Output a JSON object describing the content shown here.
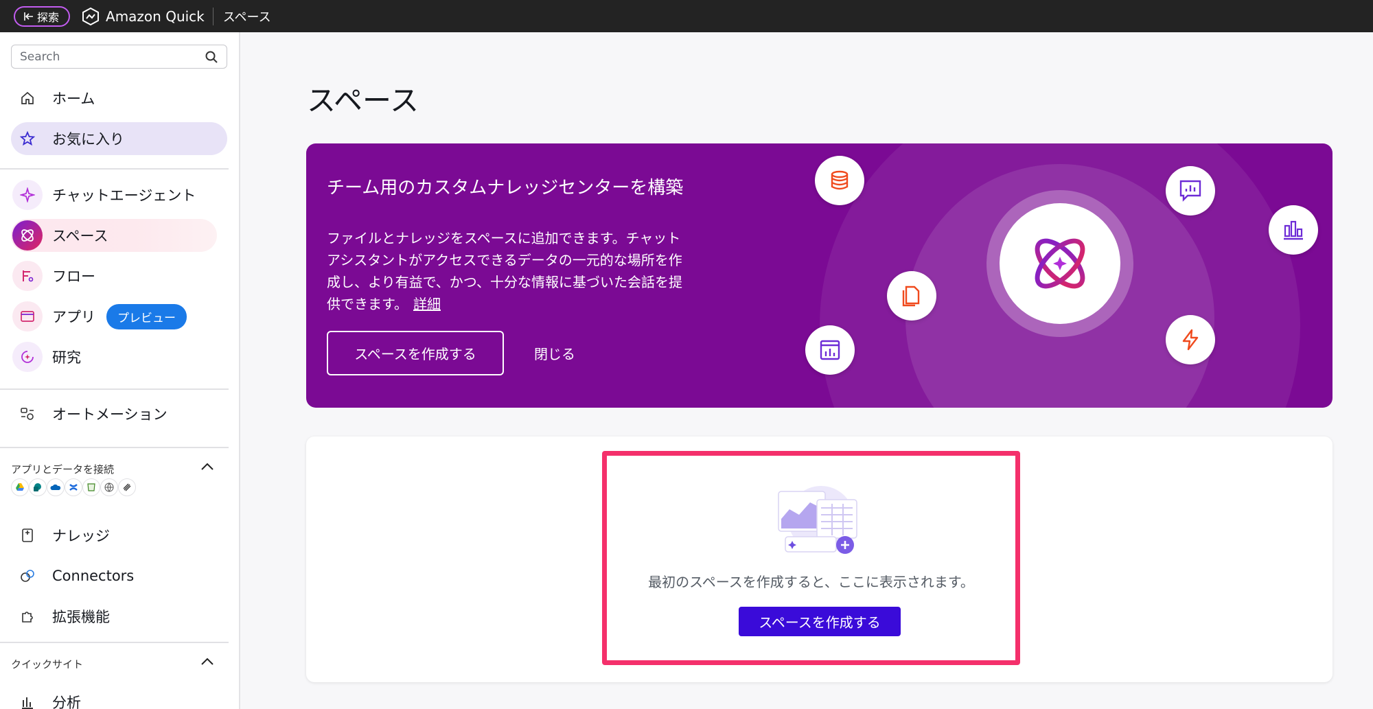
{
  "topbar": {
    "explore_label": "探索",
    "brand_name": "Amazon Quick",
    "breadcrumb": "スペース"
  },
  "sidebar": {
    "search_placeholder": "Search",
    "nav_top": [
      {
        "label": "ホーム",
        "icon": "home-icon"
      },
      {
        "label": "お気に入り",
        "icon": "star-icon"
      }
    ],
    "nav_main": [
      {
        "label": "チャットエージェント",
        "icon": "sparkle-icon"
      },
      {
        "label": "スペース",
        "icon": "space-atom-icon"
      },
      {
        "label": "フロー",
        "icon": "flow-icon"
      },
      {
        "label": "アプリ",
        "icon": "app-window-icon",
        "badge": "プレビュー"
      },
      {
        "label": "研究",
        "icon": "research-icon"
      }
    ],
    "automation": {
      "label": "オートメーション",
      "icon": "automation-icon"
    },
    "connect_section": {
      "title": "アプリとデータを接続",
      "connectors": [
        "google-drive-icon",
        "sharepoint-icon",
        "onedrive-icon",
        "confluence-icon",
        "s3-icon",
        "web-icon",
        "other-connector-icon"
      ]
    },
    "nav_data": [
      {
        "label": "ナレッジ",
        "icon": "knowledge-icon"
      },
      {
        "label": "Connectors",
        "icon": "connectors-icon"
      },
      {
        "label": "拡張機能",
        "icon": "puzzle-icon"
      }
    ],
    "quicksight_section": {
      "title": "クイックサイト",
      "items": [
        {
          "label": "分析",
          "icon": "analysis-chart-icon"
        }
      ]
    }
  },
  "main": {
    "page_title": "スペース",
    "banner": {
      "title": "チーム用のカスタムナレッジセンターを構築",
      "description": "ファイルとナレッジをスペースに追加できます。チャットアシスタントがアクセスできるデータの一元的な場所を作成し、より有益で、かつ、十分な情報に基づいた会話を提供できます。",
      "learn_more": "詳細",
      "create_button": "スペースを作成する",
      "close_button": "閉じる"
    },
    "empty_state": {
      "message": "最初のスペースを作成すると、ここに表示されます。",
      "create_button": "スペースを作成する"
    }
  },
  "colors": {
    "banner_bg": "#7b0a94",
    "primary_button": "#3a0bd9",
    "highlight_border": "#f4306b",
    "badge_bg": "#1a7ae8",
    "favorite_bg": "#e8e3f7"
  }
}
